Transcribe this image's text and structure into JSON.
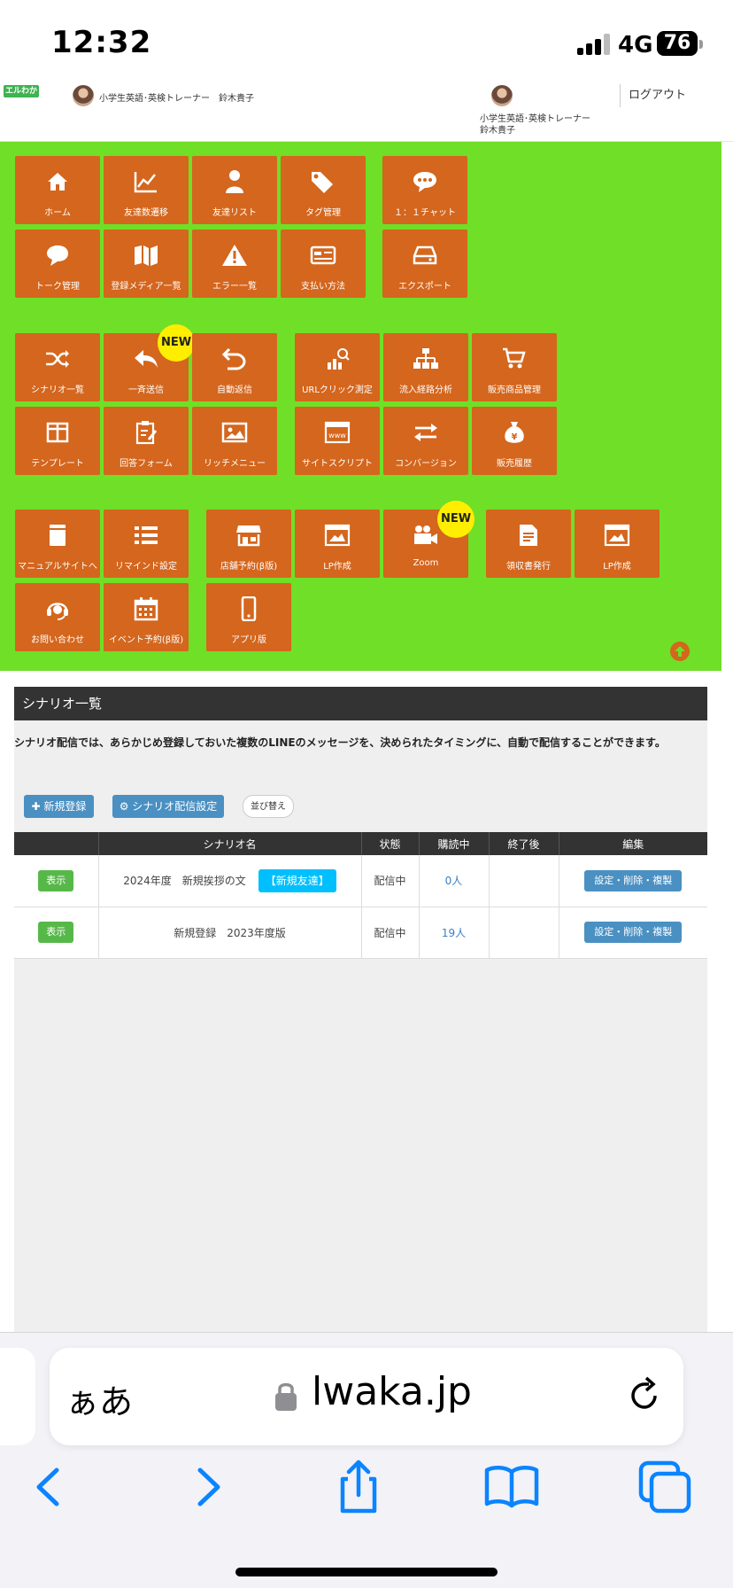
{
  "status_bar": {
    "time": "12:32",
    "network": "4G",
    "battery": "76"
  },
  "header": {
    "logo_text": "エルわか",
    "user_name_1": "小学生英語･英検トレーナー　鈴木貴子",
    "user_name_2": "小学生英語･英検トレーナー　鈴木貴子",
    "logout_label": "ログアウト"
  },
  "menu": {
    "home": "ホーム",
    "friend_trend": "友達数遷移",
    "friend_list": "友達リスト",
    "tag_manage": "タグ管理",
    "chat": "１：１チャット",
    "talk_manage": "トーク管理",
    "media_list": "登録メディア一覧",
    "error_list": "エラー一覧",
    "payment": "支払い方法",
    "export": "エクスポート",
    "scenario_list": "シナリオ一覧",
    "broadcast": "一斉送信",
    "auto_reply": "自動返信",
    "url_click": "URLクリック測定",
    "inflow_analysis": "流入経路分析",
    "sales_items": "販売商品管理",
    "template": "テンプレート",
    "answer_form": "回答フォーム",
    "rich_menu": "リッチメニュー",
    "site_script": "サイトスクリプト",
    "conversion": "コンバージョン",
    "sales_history": "販売履歴",
    "manual_site": "マニュアルサイトへ",
    "remind": "リマインド設定",
    "store_reserve": "店舗予約(β版)",
    "lp_create_1": "LP作成",
    "zoom": "Zoom",
    "receipt": "領収書発行",
    "lp_create_2": "LP作成",
    "contact": "お問い合わせ",
    "event_reserve": "イベント予約(β版)",
    "app_version": "アプリ版",
    "new_badge": "NEW"
  },
  "content": {
    "title": "シナリオ一覧",
    "description": "シナリオ配信では、あらかじめ登録しておいた複数のLINEのメッセージを、決められたタイミングに、自動で配信することができます。",
    "btn_new": "新規登録",
    "btn_setting": "シナリオ配信設定",
    "btn_sort": "並び替え",
    "table": {
      "headers": [
        "",
        "シナリオ名",
        "状態",
        "購読中",
        "終了後",
        "編集"
      ],
      "rows": [
        {
          "show": "表示",
          "name": "2024年度　新規挨拶の文",
          "tag": "【新規友達】",
          "status": "配信中",
          "subscribers": "0人",
          "after": "",
          "edit": "設定・削除・複製"
        },
        {
          "show": "表示",
          "name": "新規登録　2023年度版",
          "tag": "",
          "status": "配信中",
          "subscribers": "19人",
          "after": "",
          "edit": "設定・削除・複製"
        }
      ]
    }
  },
  "browser": {
    "aa_label": "ぁあ",
    "url": "lwaka.jp"
  },
  "colors": {
    "menu_bg": "#6fdf27",
    "tile": "#d4661d",
    "badge": "#ffee00",
    "primary_btn": "#4a90c2"
  }
}
